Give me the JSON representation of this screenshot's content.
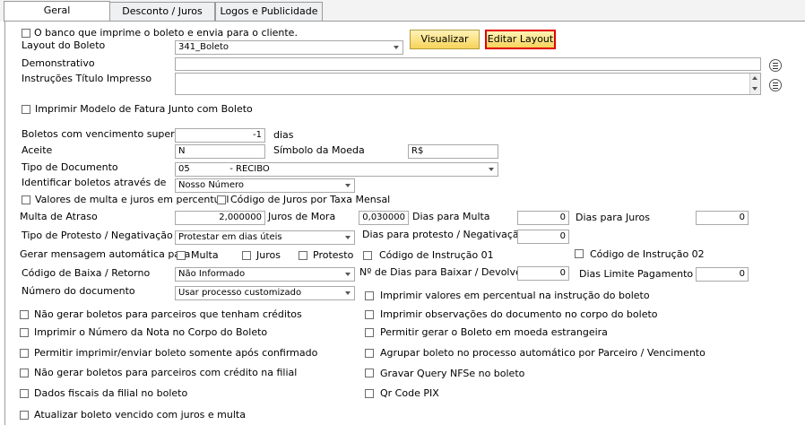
{
  "tabs": [
    {
      "label": "Geral"
    },
    {
      "label": "Desconto / Juros"
    },
    {
      "label": "Logos e Publicidade"
    }
  ],
  "banco_imprime": "O banco que imprime o boleto e envia para o cliente.",
  "layout_boleto": {
    "label": "Layout do Boleto",
    "value": "341_Boleto"
  },
  "buttons": {
    "visualizar": "Visualizar",
    "editar_layout": "Editar Layout"
  },
  "demonstrativo": {
    "label": "Demonstrativo",
    "value": ""
  },
  "instrucoes": {
    "label": "Instruções Título Impresso",
    "value": ""
  },
  "imprimir_modelo": "Imprimir Modelo de Fatura Junto com Boleto",
  "boletos_venc": {
    "label": "Boletos com vencimento superior",
    "value": "-1",
    "suffix": "dias"
  },
  "aceite": {
    "label": "Aceite",
    "value": "N"
  },
  "simbolo_moeda": {
    "label": "Símbolo da Moeda",
    "value": "R$"
  },
  "tipo_documento": {
    "label": "Tipo de Documento",
    "value": "05              - RECIBO"
  },
  "identificar": {
    "label": "Identificar boletos através de",
    "value": "Nosso Número"
  },
  "valores_multa_perc": "Valores de multa e juros em percentual",
  "codigo_juros_taxa": "Código de Juros por Taxa Mensal",
  "multa_atraso": {
    "label": "Multa de Atraso",
    "value": "2,000000"
  },
  "juros_mora": {
    "label": "Juros de Mora",
    "value": "0,030000"
  },
  "dias_multa": {
    "label": "Dias para Multa",
    "value": "0"
  },
  "dias_juros": {
    "label": "Dias para Juros",
    "value": "0"
  },
  "tipo_protesto": {
    "label": "Tipo de Protesto / Negativação",
    "value": "Protestar em dias úteis"
  },
  "dias_protesto": {
    "label": "Dias para protesto / Negativação",
    "value": "0"
  },
  "gerar_mensagem": {
    "label": "Gerar mensagem automática para",
    "multa": "Multa",
    "juros": "Juros",
    "protesto": "Protesto"
  },
  "codigo_instrucao_01": "Código de Instrução 01",
  "codigo_instrucao_02": "Código de Instrução 02",
  "codigo_baixa": {
    "label": "Código de Baixa / Retorno",
    "value": "Não Informado"
  },
  "dias_baixar": {
    "label": "Nº de Dias para Baixar / Devolver",
    "value": "0"
  },
  "dias_limite": {
    "label": "Dias Limite Pagamento",
    "value": "0"
  },
  "numero_documento": {
    "label": "Número do documento",
    "value": "Usar processo customizado"
  },
  "left_checks": [
    "Não gerar boletos para parceiros que tenham créditos",
    "Imprimir o Número da Nota no Corpo do Boleto",
    "Permitir imprimir/enviar boleto somente após confirmado",
    "Não gerar boletos para parceiros com crédito na filial",
    "Dados fiscais da filial no boleto",
    "Atualizar boleto vencido com juros e multa"
  ],
  "right_checks": [
    "Imprimir valores em percentual na instrução do boleto",
    "Imprimir observações do documento no corpo do boleto",
    "Permitir gerar o Boleto em moeda estrangeira",
    "Agrupar boleto no processo automático por Parceiro / Vencimento",
    "Gravar Query NFSe no boleto",
    "Qr Code PIX"
  ]
}
